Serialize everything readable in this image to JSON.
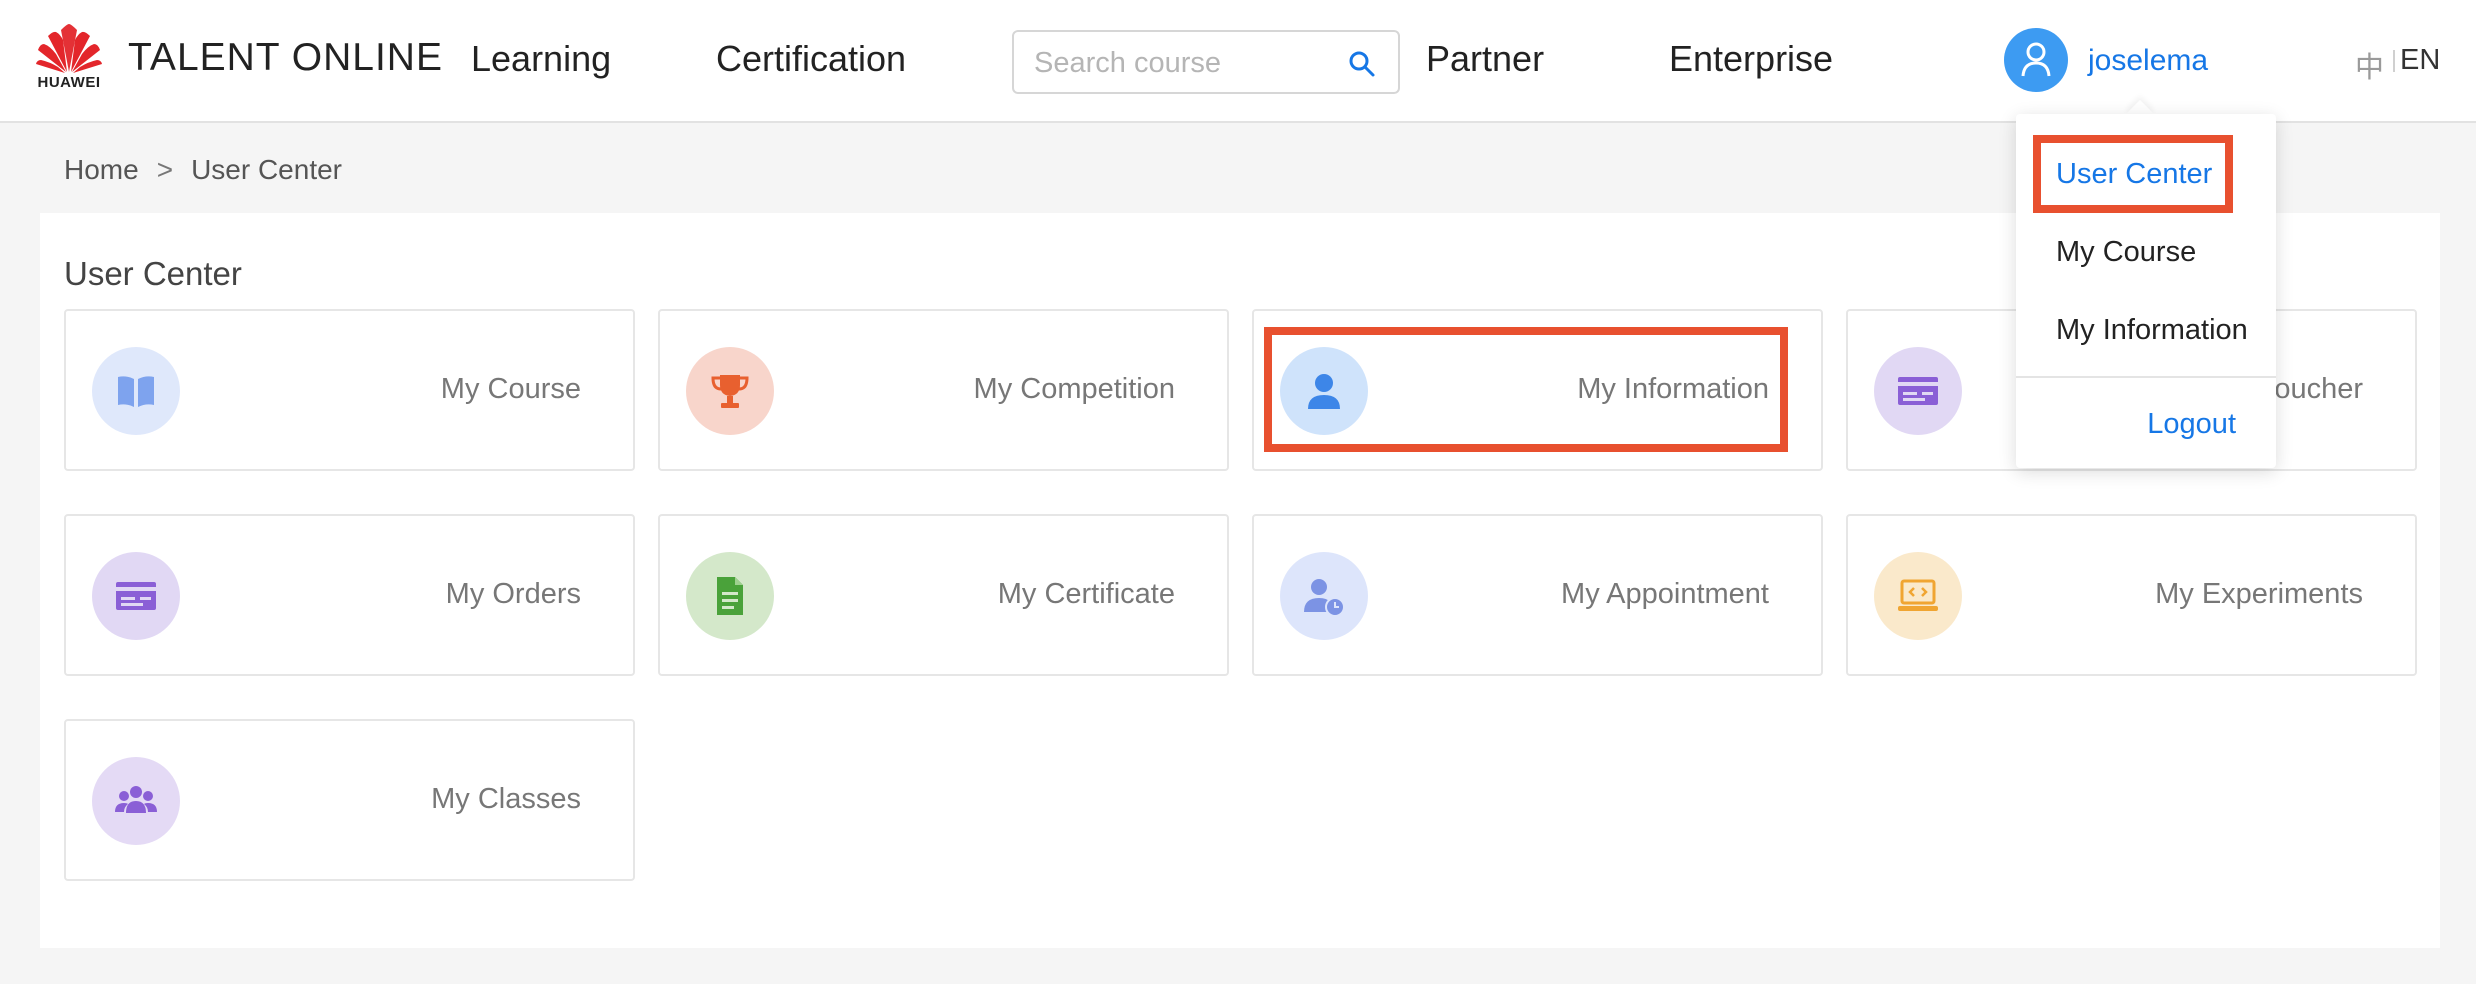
{
  "header": {
    "logo_text": "HUAWEI",
    "brand": "TALENT ONLINE",
    "nav": {
      "learning": "Learning",
      "certification": "Certification",
      "partner": "Partner",
      "enterprise": "Enterprise"
    },
    "search": {
      "placeholder": "Search course",
      "value": ""
    },
    "user": {
      "name": "joselema"
    },
    "languages": {
      "zh": "中",
      "en": "EN"
    }
  },
  "breadcrumb": {
    "home": "Home",
    "separator": ">",
    "current": "User Center"
  },
  "main": {
    "title": "User Center",
    "cards": [
      {
        "label": "My Course",
        "icon": "book-icon",
        "color": "#dfe8fb"
      },
      {
        "label": "My Competition",
        "icon": "trophy-icon",
        "color": "#f8d5cb"
      },
      {
        "label": "My Information",
        "icon": "user-icon",
        "color": "#cfe3fb"
      },
      {
        "label": "Voucher",
        "icon": "voucher-icon",
        "color": "#e1d8f4"
      },
      {
        "label": "My Orders",
        "icon": "orders-icon",
        "color": "#e1d8f4"
      },
      {
        "label": "My Certificate",
        "icon": "certificate-icon",
        "color": "#d4e8ca"
      },
      {
        "label": "My Appointment",
        "icon": "appointment-icon",
        "color": "#dde5fb"
      },
      {
        "label": "My Experiments",
        "icon": "experiments-icon",
        "color": "#fae9cb"
      },
      {
        "label": "My Classes",
        "icon": "classes-icon",
        "color": "#e4daf5"
      }
    ]
  },
  "dropdown": {
    "items": [
      "User Center",
      "My Course",
      "My Information"
    ],
    "logout": "Logout"
  },
  "colors": {
    "accent_blue": "#1677e6",
    "highlight_red": "#e8502f",
    "huawei_red": "#e3262b"
  }
}
